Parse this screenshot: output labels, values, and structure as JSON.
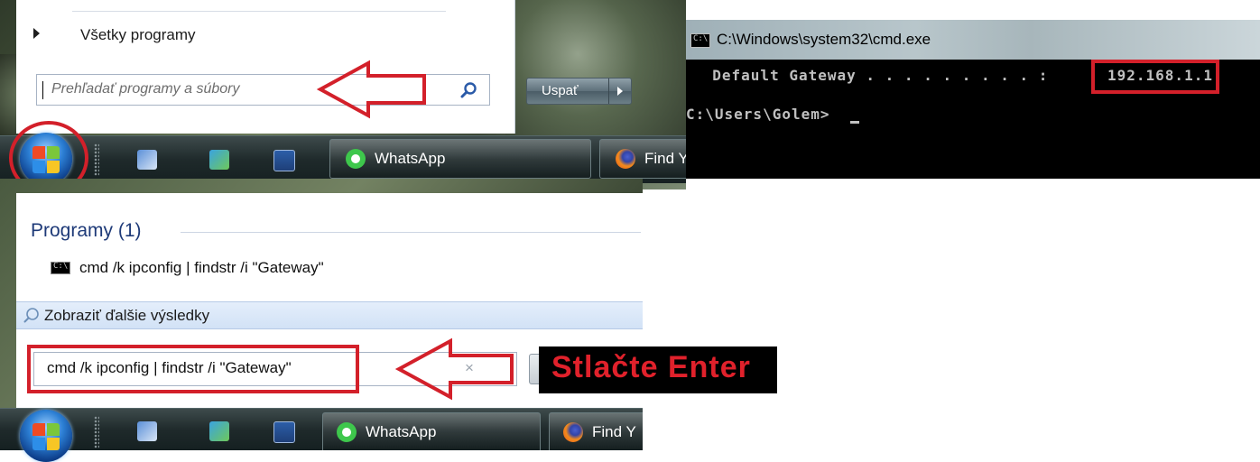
{
  "start_menu_top": {
    "all_programs_label": "Všetky programy",
    "search_placeholder": "Prehľadať programy a súbory",
    "shutdown_label": "Uspať"
  },
  "taskbar_top": {
    "whatsapp_label": "WhatsApp",
    "firefox_label": "Find Yo"
  },
  "cmd_window": {
    "title": "C:\\Windows\\system32\\cmd.exe",
    "gateway_line": "  Default Gateway . . . . . . . . . : ",
    "gateway_ip": "192.168.1.1",
    "prompt": "C:\\Users\\Golem>"
  },
  "search_results": {
    "group_title": "Programy (1)",
    "result_label": "cmd /k ipconfig | findstr /i \"Gateway\"",
    "more_results_label": "Zobraziť ďalšie výsledky",
    "search_value": "cmd /k ipconfig | findstr /i \"Gateway\"",
    "clear_glyph": "×"
  },
  "annotation": {
    "press_enter_text": "Stlačte Enter"
  },
  "taskbar_bottom": {
    "whatsapp_label": "WhatsApp",
    "firefox_label": "Find Y"
  },
  "colors": {
    "annotation_red": "#d3202a",
    "group_title_blue": "#1e3a78"
  },
  "icons": [
    "start-orb-icon",
    "network-icon",
    "transfer-icon",
    "floppy-icon",
    "whatsapp-icon",
    "firefox-icon",
    "search-icon",
    "cmd-icon",
    "chevron-right-icon",
    "arrow-left-annotation"
  ]
}
